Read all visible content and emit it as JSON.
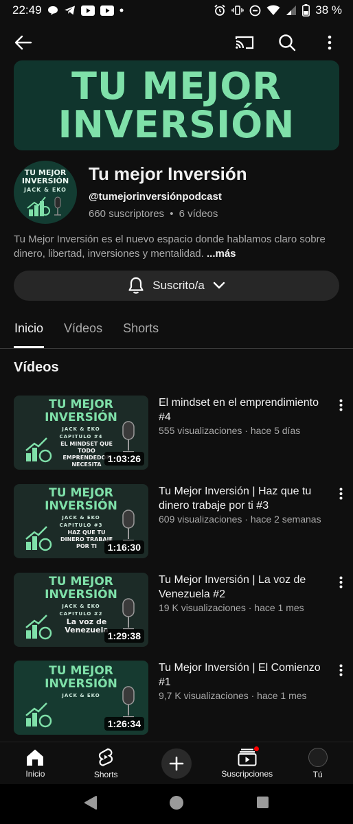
{
  "status_bar": {
    "time": "22:49",
    "battery": "38 %"
  },
  "channel": {
    "banner_line1": "TU MEJOR",
    "banner_line2": "INVERSIÓN",
    "avatar_line1": "TU MEJOR",
    "avatar_line2": "INVERSIÓN",
    "avatar_line3": "JACK & EKO",
    "name": "Tu mejor Inversión",
    "handle": "@tumejorinversiónpodcast",
    "subscribers": "660 suscriptores",
    "separator": "•",
    "videos_count": "6 vídeos",
    "description": "Tu Mejor Inversión es el nuevo espacio donde hablamos claro sobre dinero, libertad, inversiones y mentalidad.",
    "more": "...más",
    "subscribe_label": "Suscrito/a"
  },
  "tabs": [
    {
      "label": "Inicio",
      "active": true
    },
    {
      "label": "Vídeos",
      "active": false
    },
    {
      "label": "Shorts",
      "active": false
    }
  ],
  "section_title": "Vídeos",
  "videos": [
    {
      "title": "El mindset en el emprendimiento #4",
      "meta": "555 visualizaciones · hace 5 días",
      "duration": "1:03:26",
      "thumb_line1": "TU MEJOR",
      "thumb_line2": "INVERSIÓN",
      "thumb_sub": "JACK & EKO",
      "thumb_chapter": "CAPITULO #4",
      "thumb_caption": "EL MINDSET QUE TODO EMPRENDEDOR NECESITA"
    },
    {
      "title": "Tu Mejor Inversión | Haz que tu dinero trabaje por ti #3",
      "meta": "609 visualizaciones · hace 2 semanas",
      "duration": "1:16:30",
      "thumb_line1": "TU MEJOR",
      "thumb_line2": "INVERSIÓN",
      "thumb_sub": "JACK & EKO",
      "thumb_chapter": "CAPITULO #3",
      "thumb_caption": "HAZ QUE TU DINERO TRABAJE POR TI"
    },
    {
      "title": "Tu Mejor Inversión | La voz de Venezuela #2",
      "meta": "19 K visualizaciones · hace 1 mes",
      "duration": "1:29:38",
      "thumb_line1": "TU MEJOR",
      "thumb_line2": "INVERSIÓN",
      "thumb_sub": "JACK & EKO",
      "thumb_chapter": "CAPITULO #2",
      "thumb_caption": "La voz de Venezuela"
    },
    {
      "title": "Tu Mejor Inversión | El Comienzo #1",
      "meta": "9,7 K visualizaciones · hace 1 mes",
      "duration": "1:26:34",
      "thumb_line1": "TU MEJOR",
      "thumb_line2": "INVERSIÓN",
      "thumb_sub": "JACK & EKO",
      "thumb_chapter": "",
      "thumb_caption": ""
    }
  ],
  "bottom_nav": [
    {
      "label": "Inicio",
      "icon": "home-icon"
    },
    {
      "label": "Shorts",
      "icon": "shorts-icon"
    },
    {
      "label": "",
      "icon": "create-icon"
    },
    {
      "label": "Suscripciones",
      "icon": "subscriptions-icon"
    },
    {
      "label": "Tú",
      "icon": "you-avatar"
    }
  ],
  "colors": {
    "background": "#0f0f0f",
    "accent_green": "#7fe0a9",
    "banner_bg": "#10352d",
    "notification": "#ff0000"
  }
}
